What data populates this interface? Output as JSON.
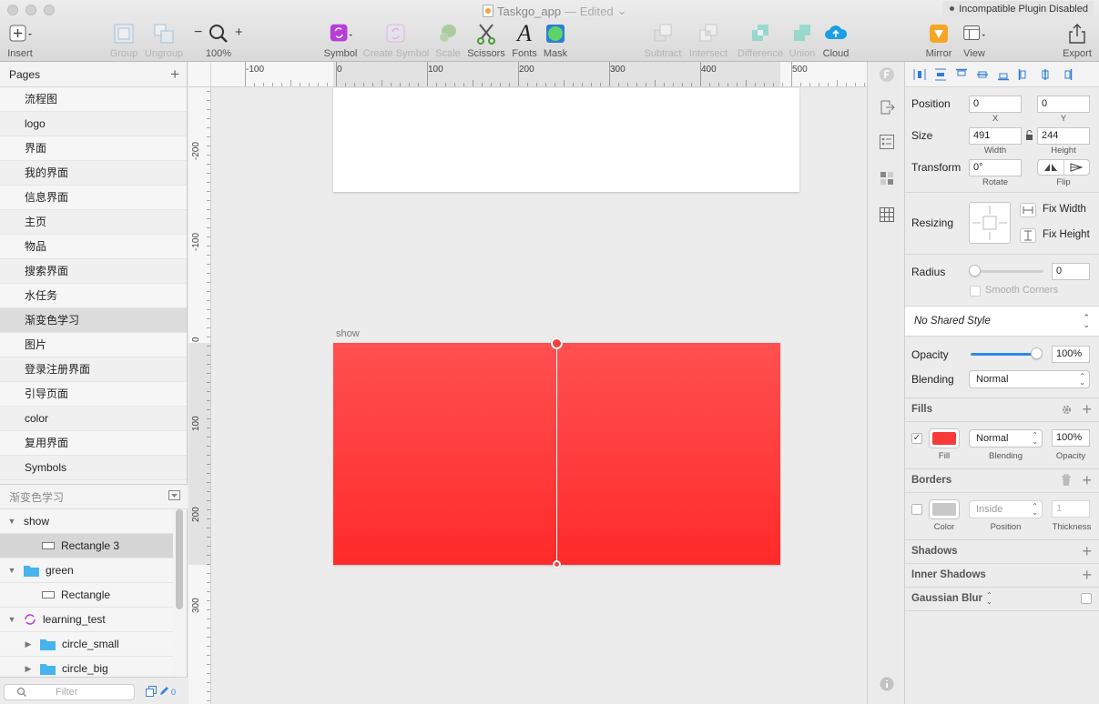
{
  "window": {
    "title": "Taskgo_app",
    "status": "— Edited",
    "notice": "Incompatible Plugin Disabled"
  },
  "toolbar": {
    "insert": "Insert",
    "group": "Group",
    "ungroup": "Ungroup",
    "zoom_minus": "−",
    "zoom_plus": "+",
    "zoom": "100%",
    "symbol": "Symbol",
    "create_symbol": "Create Symbol",
    "scale": "Scale",
    "scissors": "Scissors",
    "fonts": "Fonts",
    "mask": "Mask",
    "subtract": "Subtract",
    "intersect": "Intersect",
    "difference": "Difference",
    "union": "Union",
    "cloud": "Cloud",
    "mirror": "Mirror",
    "view": "View",
    "export": "Export"
  },
  "pages": {
    "header": "Pages",
    "add": "+",
    "items": [
      "流程图",
      "logo",
      "界面",
      "我的界面",
      "信息界面",
      "主页",
      "物品",
      "搜索界面",
      "水任务",
      "渐变色学习",
      "图片",
      "登录注册界面",
      "引导页面",
      "color",
      "复用界面",
      "Symbols"
    ],
    "selected": "渐变色学习"
  },
  "layers": {
    "header": "渐变色学习",
    "items": [
      {
        "label": "show",
        "kind": "artboard",
        "expanded": true,
        "indent": 0
      },
      {
        "label": "Rectangle 3",
        "kind": "rect",
        "indent": 1,
        "selected": true
      },
      {
        "label": "green",
        "kind": "folder",
        "expanded": true,
        "indent": 0
      },
      {
        "label": "Rectangle",
        "kind": "rect",
        "indent": 1
      },
      {
        "label": "learning_test",
        "kind": "symbol",
        "expanded": true,
        "indent": 0
      },
      {
        "label": "circle_small",
        "kind": "folder",
        "expanded": false,
        "indent": 1
      },
      {
        "label": "circle_big",
        "kind": "folder",
        "expanded": false,
        "indent": 1
      }
    ],
    "filter_placeholder": "Filter",
    "filter_count": "0"
  },
  "rulers": {
    "top": [
      "-100",
      "0",
      "100",
      "200",
      "300",
      "400",
      "500"
    ],
    "left": [
      "-200",
      "-100",
      "0",
      "100",
      "200",
      "300"
    ]
  },
  "canvas": {
    "artboard_name": "show",
    "fill_top": "#ff5050",
    "fill_bottom": "#ff2a2a"
  },
  "inspector": {
    "position_label": "Position",
    "x": "0",
    "x_label": "X",
    "y": "0",
    "y_label": "Y",
    "size_label": "Size",
    "width": "491",
    "width_label": "Width",
    "height": "244",
    "height_label": "Height",
    "transform_label": "Transform",
    "rotate": "0°",
    "rotate_label": "Rotate",
    "flip_label": "Flip",
    "resizing_label": "Resizing",
    "fix_width": "Fix Width",
    "fix_height": "Fix Height",
    "radius_label": "Radius",
    "radius": "0",
    "smooth_corners": "Smooth Corners",
    "shared_style": "No Shared Style",
    "opacity_label": "Opacity",
    "opacity": "100%",
    "opacity_fraction": 1.0,
    "blending_label": "Blending",
    "blending": "Normal",
    "fills_title": "Fills",
    "fill": {
      "enabled": true,
      "color": "#f73a3a",
      "blending": "Normal",
      "opacity": "100%",
      "color_label": "Fill",
      "blending_label": "Blending",
      "opacity_label": "Opacity"
    },
    "borders_title": "Borders",
    "border": {
      "enabled": false,
      "color": "#c8c8c8",
      "position": "Inside",
      "thickness": "1",
      "color_label": "Color",
      "position_label": "Position",
      "thickness_label": "Thickness"
    },
    "shadows_title": "Shadows",
    "inner_shadows_title": "Inner Shadows",
    "gaussian_blur_title": "Gaussian Blur"
  }
}
